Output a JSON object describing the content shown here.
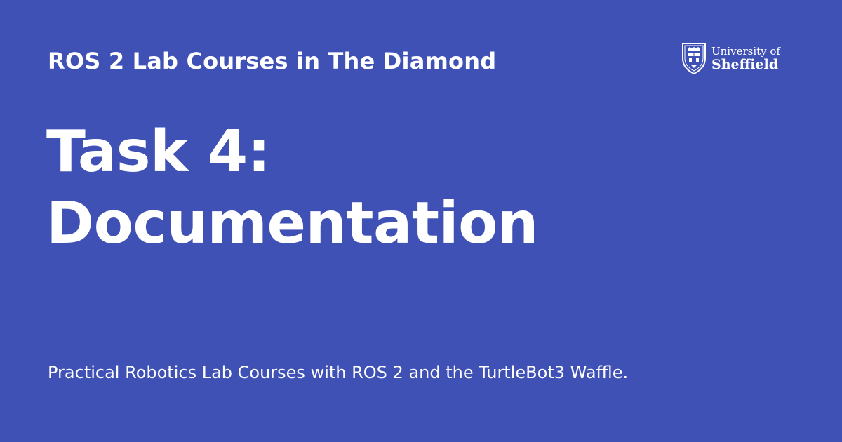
{
  "header": {
    "site_title": "ROS 2 Lab Courses in The Diamond"
  },
  "main": {
    "title_line1": "Task 4:",
    "title_line2": "Documentation",
    "description": "Practical Robotics Lab Courses with ROS 2 and the TurtleBot3 Waffle."
  },
  "logo": {
    "line1": "University of",
    "line2": "Sheffield",
    "icon": "university-crest-icon"
  },
  "colors": {
    "background": "#3f51b5",
    "text": "#ffffff"
  }
}
